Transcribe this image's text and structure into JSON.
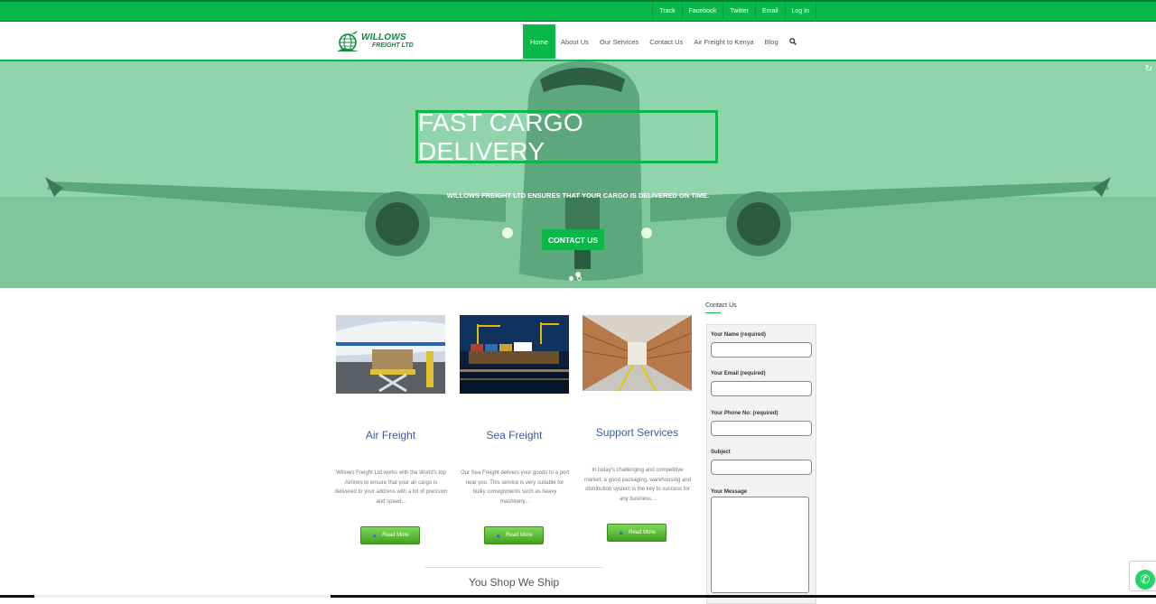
{
  "topbar": {
    "links": [
      "Track",
      "Facebook",
      "Twitter",
      "Email",
      "Log In"
    ]
  },
  "logo": {
    "line1": "WILLOWS",
    "line2": "FREIGHT LTD"
  },
  "nav": {
    "items": [
      "Home",
      "About Us",
      "Our Services",
      "Contact Us",
      "Air Freight to Kenya",
      "Blog"
    ],
    "search_icon": "search-icon"
  },
  "hero": {
    "title": "FAST CARGO DELIVERY",
    "subtitle": "WILLOWS FREIGHT LTD ENSURES THAT YOUR CARGO IS DELIVERED ON TIME.",
    "button": "CONTACT US",
    "corner": "↻"
  },
  "services": [
    {
      "title": "Air Freight",
      "text": "Willows Freight Ltd works with the World's top Airlines to ensure that your air cargo is delivered to your address with a lot of precision and speed...",
      "button": "Read More"
    },
    {
      "title": "Sea Freight",
      "text": "Our Sea Freight delivers your goods to a port near you. This service is very suitable for bulky consignments such as heavy machinery...",
      "button": "Read More"
    },
    {
      "title": "Support Services",
      "text": "In today's challenging and competitive market, a good packaging, warehousing and distribution system is the key to success for any business...",
      "button": "Read More"
    }
  ],
  "section_heading": "You Shop We Ship",
  "contact": {
    "title": "Contact Us",
    "fields": {
      "name": "Your Name (required)",
      "email": "Your Email (required)",
      "phone": "Your Phone No: (required)",
      "subject": "Subject",
      "message": "Your Message"
    }
  },
  "colors": {
    "brand_green": "#0ab84a",
    "hero_tint": "#88d3a6",
    "link_blue": "#3b5aa0",
    "button_green": "#45a020"
  }
}
